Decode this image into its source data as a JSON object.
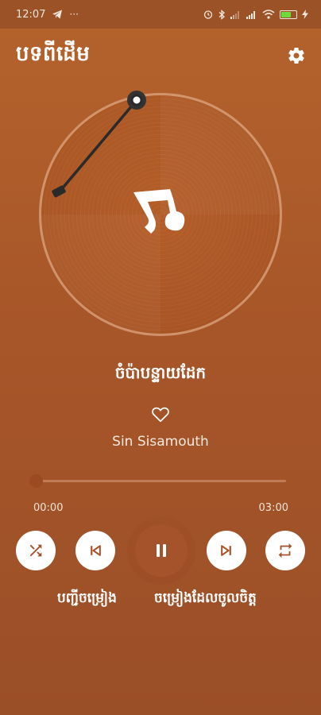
{
  "status_bar": {
    "time": "12:07"
  },
  "header": {
    "title": "បទពីដើម"
  },
  "player": {
    "song_title": "ចំប៉ាបន្ទាយដែក",
    "artist": "Sin Sisamouth",
    "progress": 0.0,
    "time_current": "00:00",
    "time_total": "03:00",
    "state": "playing"
  },
  "links": {
    "playlist": "បញ្ជីចម្រៀង",
    "favorites": "ចម្រៀងដែលចូលចិត្ត"
  },
  "colors": {
    "background": "#a75629",
    "status_bar": "#9a5226",
    "control_fill": "#ffffff",
    "control_icon": "#a4532a"
  },
  "icons": {
    "settings": "gear-icon",
    "like": "heart-icon",
    "shuffle": "shuffle-icon",
    "previous": "skip-previous-icon",
    "play_pause": "pause-icon",
    "next": "skip-next-icon",
    "repeat": "repeat-icon"
  }
}
